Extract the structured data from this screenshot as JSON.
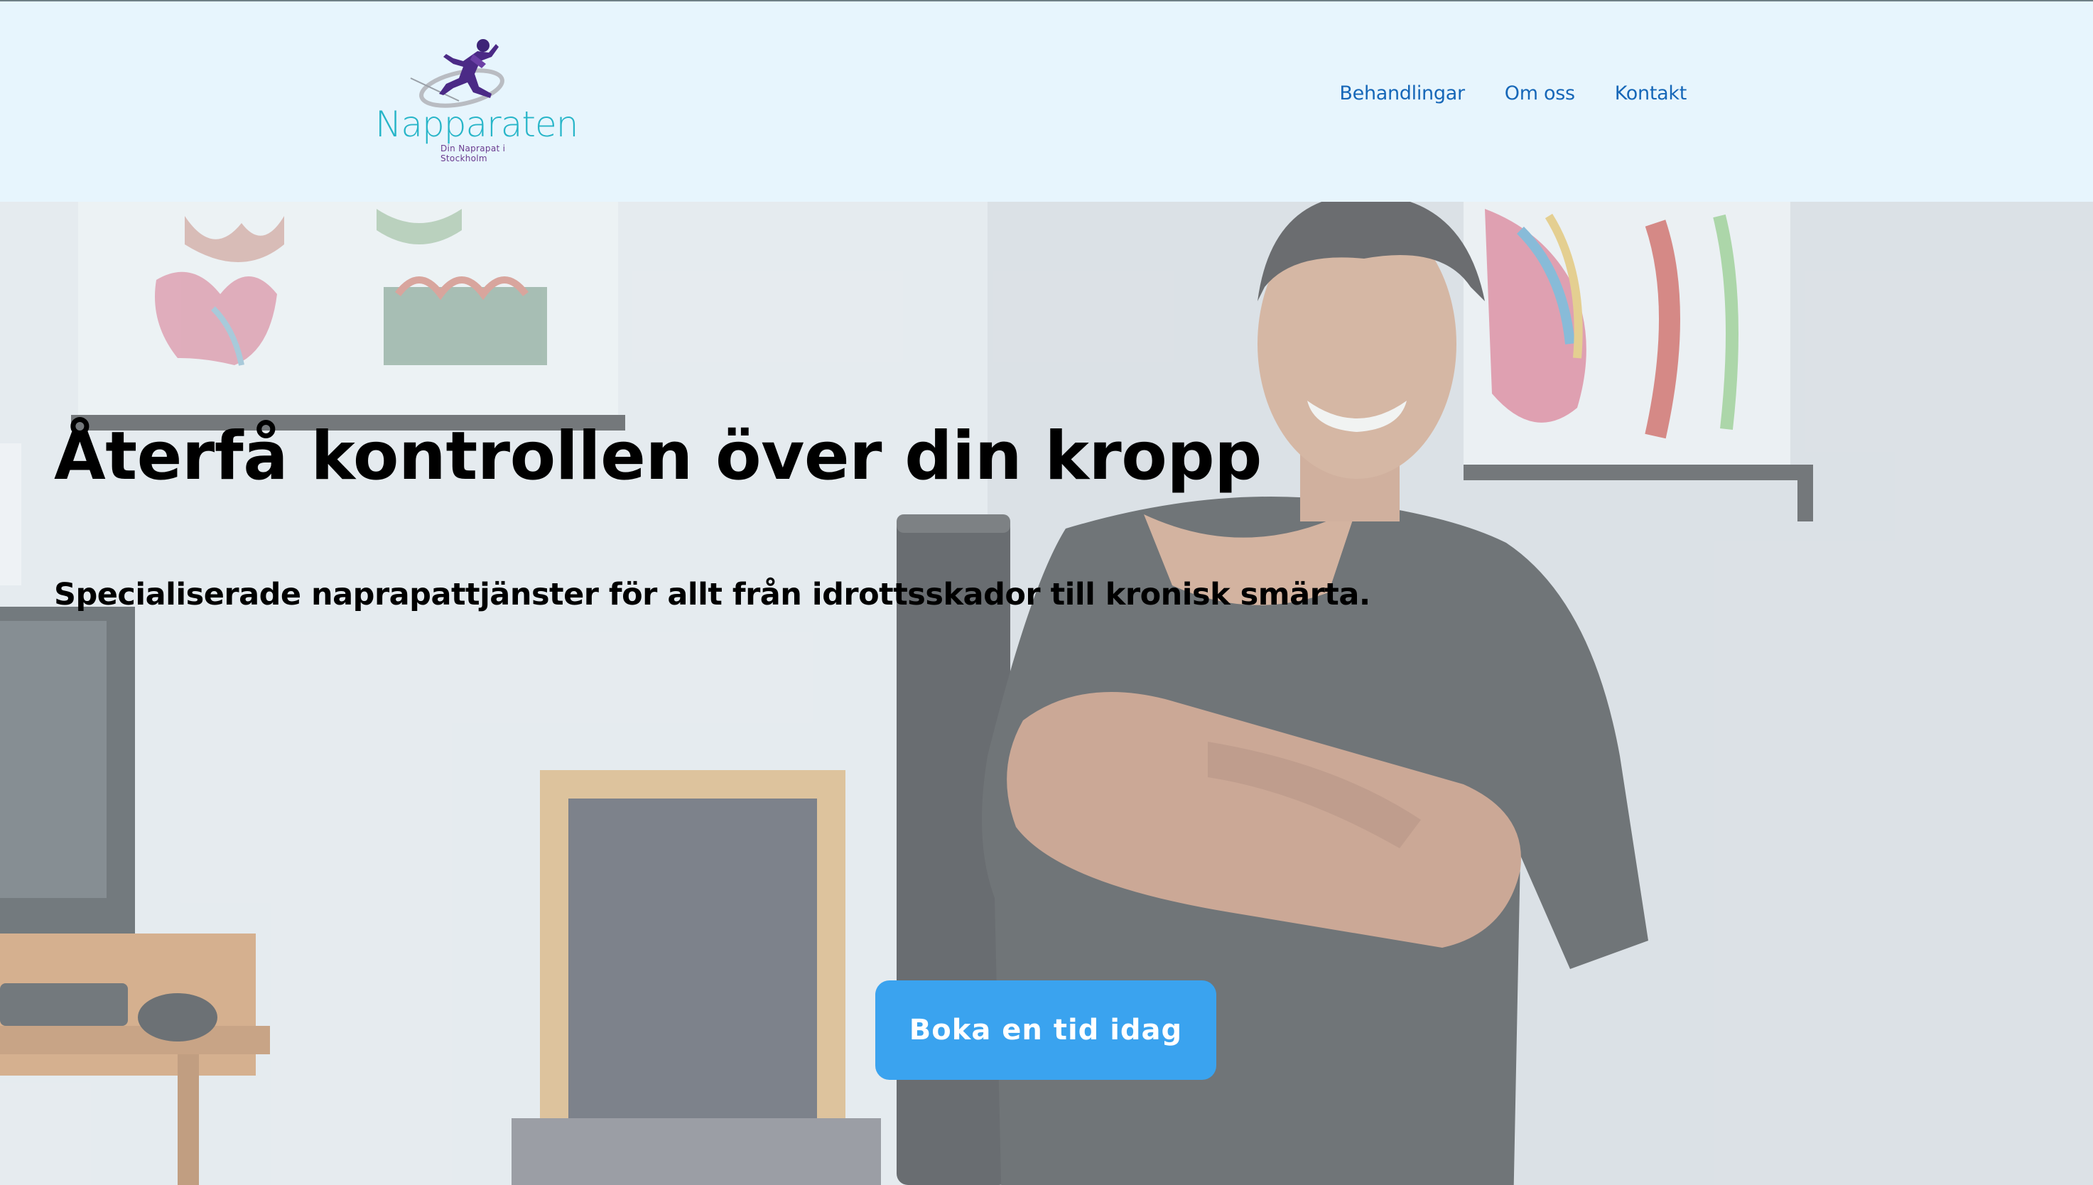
{
  "header": {
    "logo": {
      "word": "Napparaten",
      "tagline": "Din Naprapat i Stockholm",
      "icon": "running-athlete-icon"
    },
    "nav": [
      {
        "label": "Behandlingar"
      },
      {
        "label": "Om oss"
      },
      {
        "label": "Kontakt"
      }
    ]
  },
  "hero": {
    "title": "Återfå kontrollen över din kropp",
    "subtitle": "Specialiserade naprapattjänster för allt från idrottsskador till kronisk smärta.",
    "cta_label": "Boka en tid idag",
    "background": "clinic-photo-naprapath-arms-crossed"
  },
  "colors": {
    "header_bg": "#e7f5fd",
    "nav_link": "#1667b8",
    "cta_bg": "#3aa3ef",
    "logo_teal": "#27b5c8",
    "logo_purple": "#4b2a86"
  }
}
